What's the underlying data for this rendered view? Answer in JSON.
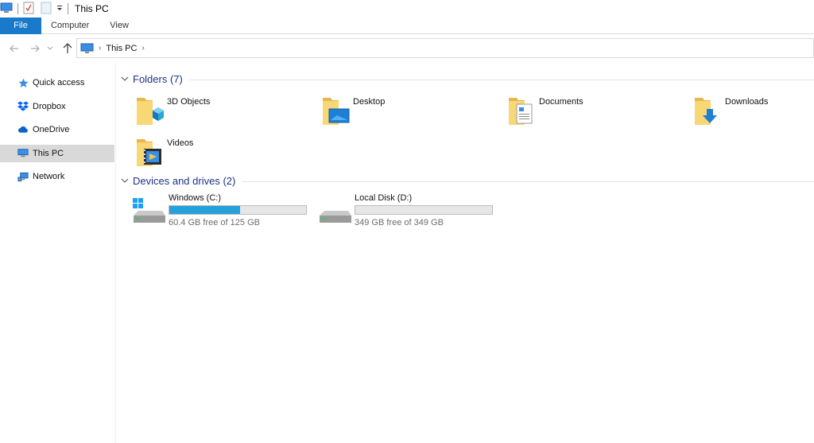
{
  "window": {
    "title": "This PC"
  },
  "ribbon": {
    "tabs": [
      "File",
      "Computer",
      "View"
    ]
  },
  "address": {
    "crumbs": [
      "This PC"
    ]
  },
  "sidebar": {
    "items": [
      {
        "label": "Quick access",
        "icon": "star-icon"
      },
      {
        "label": "Dropbox",
        "icon": "dropbox-icon"
      },
      {
        "label": "OneDrive",
        "icon": "cloud-icon"
      },
      {
        "label": "This PC",
        "icon": "computer-icon",
        "selected": true
      },
      {
        "label": "Network",
        "icon": "network-icon"
      }
    ]
  },
  "folders": {
    "header": "Folders (7)",
    "items": [
      {
        "label": "3D Objects",
        "overlay": "cube-icon"
      },
      {
        "label": "Desktop",
        "overlay": "monitor-icon"
      },
      {
        "label": "Documents",
        "overlay": "document-icon"
      },
      {
        "label": "Downloads",
        "overlay": "download-arrow-icon"
      },
      {
        "label": "Videos",
        "overlay": "film-icon"
      }
    ]
  },
  "drives": {
    "header": "Devices and drives (2)",
    "items": [
      {
        "name": "Windows (C:)",
        "free_text": "60.4 GB free of 125 GB",
        "used_fraction": 0.517,
        "icon": "windows-drive-icon"
      },
      {
        "name": "Local Disk (D:)",
        "free_text": "349 GB free of 349 GB",
        "used_fraction": 0.0,
        "icon": "local-disk-icon"
      }
    ]
  },
  "colors": {
    "accent": "#1979ca",
    "bar_fill": "#26a0da",
    "group_title": "#1e3287",
    "selected_bg": "#d9d9d9"
  }
}
